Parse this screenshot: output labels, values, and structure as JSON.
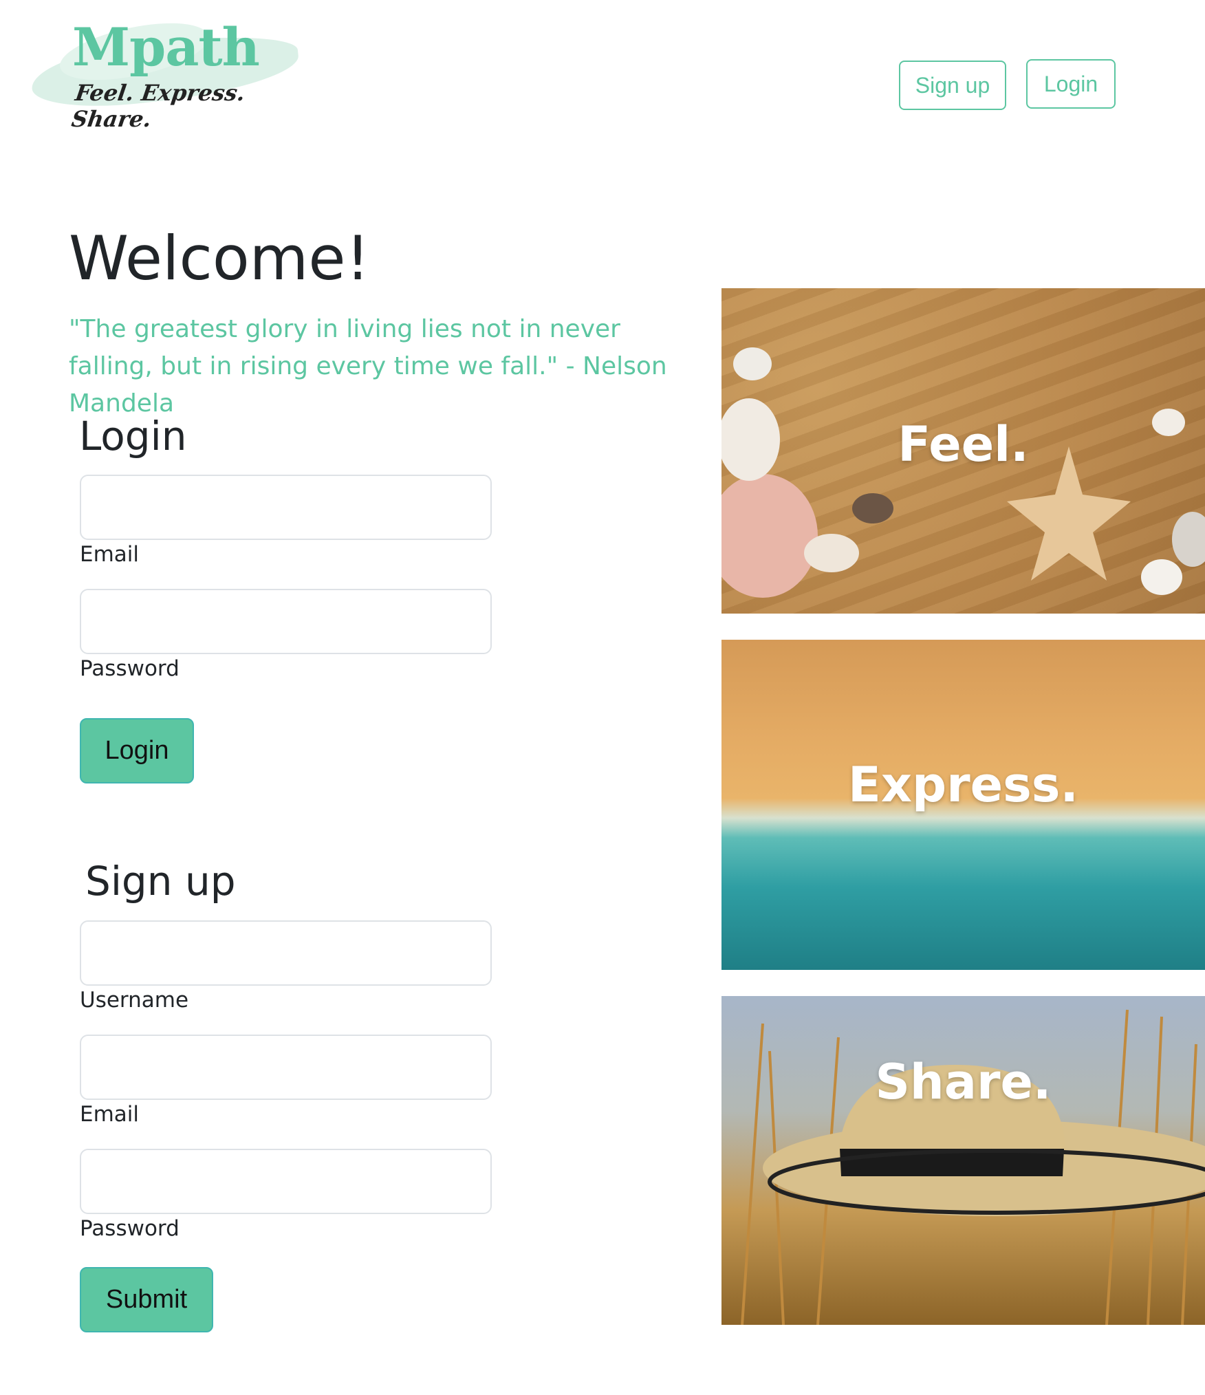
{
  "header": {
    "brand": "Mpath",
    "tagline": "Feel. Express. Share.",
    "nav": {
      "signup_label": "Sign up",
      "login_label": "Login"
    }
  },
  "main": {
    "title": "Welcome!",
    "quote": "\"The greatest glory in living lies not in never falling, but in rising every time we fall.\" - Nelson Mandela",
    "login": {
      "title": "Login",
      "email_label": "Email",
      "password_label": "Password",
      "button_label": "Login"
    },
    "signup": {
      "title": "Sign up",
      "username_label": "Username",
      "email_label": "Email",
      "password_label": "Password",
      "button_label": "Submit"
    }
  },
  "gallery": [
    {
      "caption": "Feel."
    },
    {
      "caption": "Express."
    },
    {
      "caption": "Share."
    }
  ],
  "colors": {
    "accent": "#5cc6a1",
    "text": "#212529",
    "border": "#dee2e6"
  }
}
